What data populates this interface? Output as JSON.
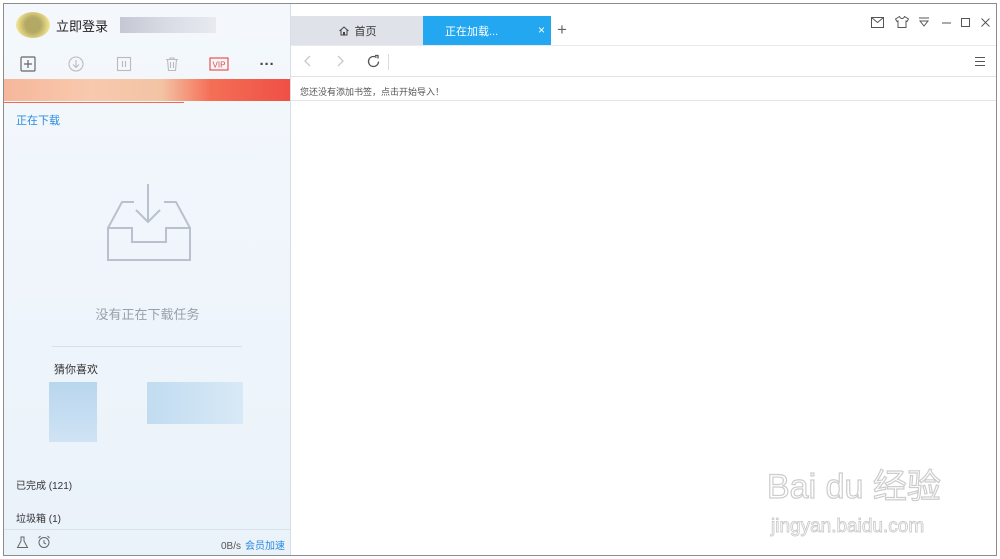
{
  "sidebar": {
    "login_label": "立即登录",
    "downloading_link": "正在下载",
    "empty_text": "没有正在下载任务",
    "guess_title": "猜你喜欢",
    "completed": "已完成 (121)",
    "trash": "垃圾箱 (1)",
    "speed": "0B/s",
    "vip_boost": "会员加速",
    "toolbar_icons": [
      "new-task-icon",
      "start-icon",
      "pause-icon",
      "delete-icon",
      "vip-icon",
      "more-icon"
    ],
    "vip_badge": "VIP",
    "more_label": "···"
  },
  "browser": {
    "tabs": [
      {
        "label": "首页",
        "icon": "home-icon"
      },
      {
        "label": "正在加载...",
        "active": true
      }
    ],
    "tab_close": "×",
    "tab_add": "+",
    "bookmark_hint": "您还没有添加书签，点击开始导入！",
    "window_controls": [
      "mail-icon",
      "skin-icon",
      "menu-down-icon",
      "minimize-icon",
      "maximize-icon",
      "close-icon"
    ],
    "nav_icons": [
      "back-icon",
      "forward-icon",
      "refresh-icon",
      "menu-icon"
    ]
  },
  "watermark": {
    "brand": "Bai du 经验",
    "url": "jingyan.baidu.com"
  },
  "colors": {
    "accent": "#22a7f0",
    "link": "#2a8be0",
    "vip": "#e8463c"
  }
}
